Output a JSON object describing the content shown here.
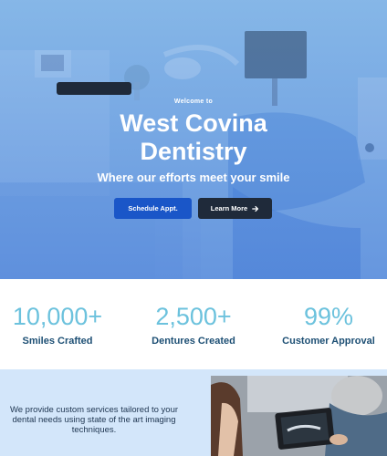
{
  "hero": {
    "welcome": "Welcome to",
    "title_line1": "West Covina",
    "title_line2": "Dentistry",
    "tagline": "Where our efforts meet your smile",
    "schedule_label": "Schedule Appt.",
    "learn_label": "Learn More",
    "arrow_icon": "arrow-right-icon"
  },
  "stats": [
    {
      "number": "10,000+",
      "label": "Smiles Crafted"
    },
    {
      "number": "2,500+",
      "label": "Dentures Created"
    },
    {
      "number": "99%",
      "label": "Customer Approval"
    }
  ],
  "services": {
    "text": "We provide custom services tailored to your dental needs using state of the art imaging techniques."
  },
  "colors": {
    "primary_button": "#1a56c8",
    "dark_button": "#1f2a3a",
    "stat_number": "#6cc2dd",
    "stat_label": "#1d4f74",
    "services_bg": "#d3e6fa"
  }
}
